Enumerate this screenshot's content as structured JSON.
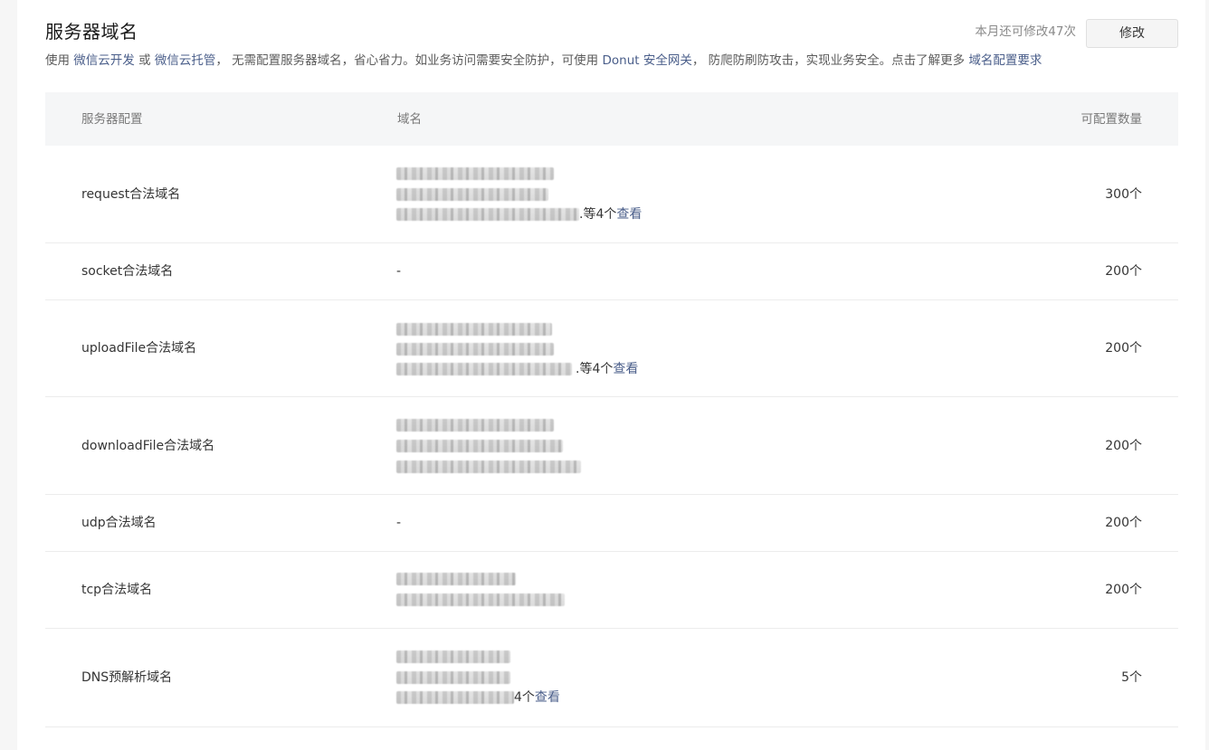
{
  "header": {
    "title": "服务器域名",
    "quota_text": "本月还可修改47次",
    "modify_label": "修改"
  },
  "description": {
    "prefix": "使用 ",
    "link1": "微信云开发",
    "or": " 或 ",
    "link2": "微信云托管",
    "middle": "， 无需配置服务器域名，省心省力。如业务访问需要安全防护，可使用 ",
    "link3": "Donut 安全网关",
    "after_link3": "， 防爬防刷防攻击，实现业务安全。点击了解更多 ",
    "link4": "域名配置要求"
  },
  "table": {
    "headers": {
      "config": "服务器配置",
      "domain": "域名",
      "count": "可配置数量"
    },
    "rows": [
      {
        "label": "request合法域名",
        "empty": "",
        "more_text": ".等4个",
        "view": "查看",
        "count": "300个"
      },
      {
        "label": "socket合法域名",
        "empty": "-",
        "more_text": "",
        "view": "",
        "count": "200个"
      },
      {
        "label": "uploadFile合法域名",
        "empty": "",
        "more_text": ".等4个",
        "view": "查看",
        "count": "200个"
      },
      {
        "label": "downloadFile合法域名",
        "empty": "",
        "more_text": "",
        "view": "",
        "count": "200个"
      },
      {
        "label": "udp合法域名",
        "empty": "-",
        "more_text": "",
        "view": "",
        "count": "200个"
      },
      {
        "label": "tcp合法域名",
        "empty": "",
        "more_text": "",
        "view": "",
        "count": "200个"
      },
      {
        "label": "DNS预解析域名",
        "empty": "",
        "more_text": "4个",
        "view": "查看",
        "count": "5个"
      }
    ]
  }
}
